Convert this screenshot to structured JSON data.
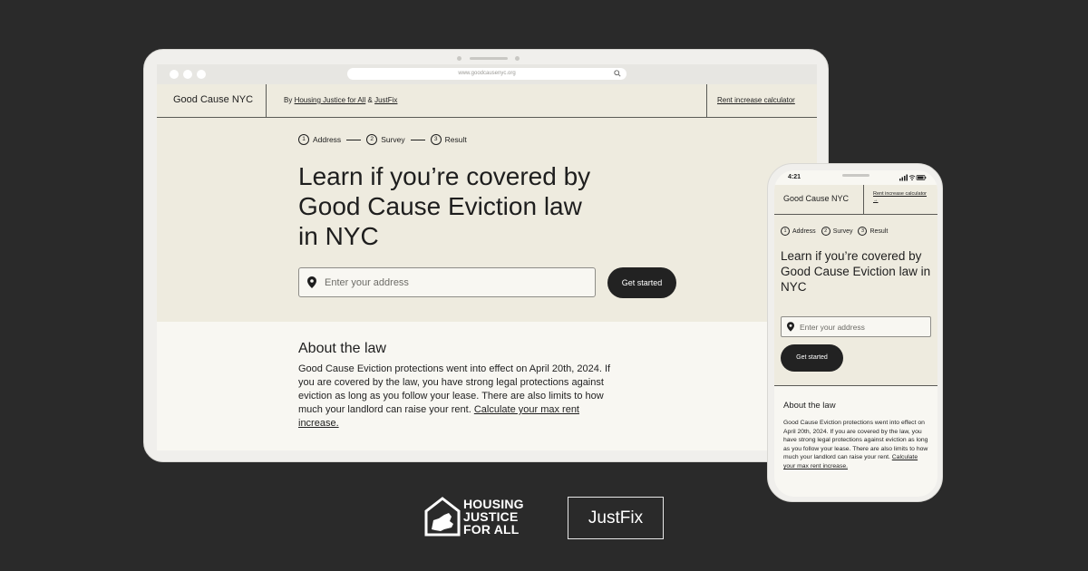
{
  "tablet": {
    "browser": {
      "url": "www.goodcausenyc.org"
    },
    "header": {
      "brand": "Good Cause NYC",
      "by": "By",
      "org1": "Housing Justice for All",
      "amp": "&",
      "org2": "JustFix",
      "calculator_link": "Rent increase calculator"
    },
    "steps": [
      {
        "num": "1",
        "label": "Address"
      },
      {
        "num": "2",
        "label": "Survey"
      },
      {
        "num": "3",
        "label": "Result"
      }
    ],
    "hero_title": "Learn if you’re covered by Good Cause Eviction law in NYC",
    "address_placeholder": "Enter your address",
    "cta": "Get started",
    "about": {
      "heading": "About the law",
      "body": "Good Cause Eviction protections went into effect on April 20th, 2024. If you are covered by the law, you have strong legal protections against eviction as long as you follow your lease. There are also limits to how much your landlord can raise your rent.",
      "link": "Calculate your max rent increase."
    }
  },
  "phone": {
    "time": "4:21",
    "header": {
      "brand": "Good Cause NYC",
      "calculator_link": "Rent increase calculator",
      "arrow": "→"
    },
    "steps": [
      {
        "num": "1",
        "label": "Address"
      },
      {
        "num": "2",
        "label": "Survey"
      },
      {
        "num": "3",
        "label": "Result"
      }
    ],
    "hero_title": "Learn if you’re covered by Good Cause Eviction law in NYC",
    "address_placeholder": "Enter your address",
    "cta": "Get started",
    "about": {
      "heading": "About the law",
      "body": "Good Cause Eviction protections went into effect on April 20th, 2024. If you are covered by the law, you have strong legal protections against eviction as long as you follow your lease. There are also limits to how much your landlord can raise your rent.",
      "link": "Calculate your max rent increase."
    }
  },
  "logos": {
    "hjfa": [
      "HOUSING",
      "JUSTICE",
      "FOR ALL"
    ],
    "justfix": "JustFix"
  },
  "colors": {
    "background": "#2a2a2a",
    "hero_beige": "#eeebdf",
    "page_cream": "#f8f7f2",
    "button_dark": "#222222"
  }
}
